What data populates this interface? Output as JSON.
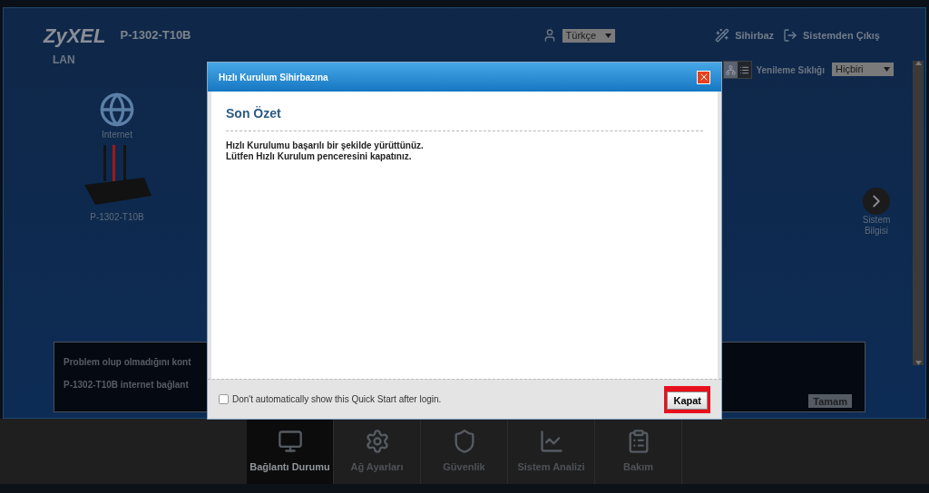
{
  "header": {
    "logo": "ZyXEL",
    "model": "P-1302-T10B",
    "language": {
      "value": "Türkçe"
    },
    "links": [
      {
        "label": "Sihirbaz",
        "kind": "wizard"
      },
      {
        "label": "Sistemden Çıkış",
        "kind": "logout"
      }
    ]
  },
  "page": {
    "title": "LAN",
    "refresh_label": "Yenileme Sıklığı",
    "refresh": {
      "value": "Hiçbiri"
    },
    "view_toggle": [
      {
        "kind": "diagram",
        "selected": true
      },
      {
        "kind": "list",
        "selected": false
      }
    ]
  },
  "diagram": {
    "internet_label": "Internet",
    "device_label": "P-1302-T10B"
  },
  "side_link": {
    "label": "Sistem Bilgisi"
  },
  "notice": {
    "lines": [
      "Problem olup olmadığını kont",
      "P-1302-T10B internet bağlant"
    ],
    "button": "Tamam"
  },
  "nav": [
    {
      "label": "Bağlantı Durumu",
      "kind": "status",
      "selected": true
    },
    {
      "label": "Ağ Ayarları",
      "kind": "network",
      "selected": false
    },
    {
      "label": "Güvenlik",
      "kind": "security",
      "selected": false
    },
    {
      "label": "Sistem Analizi",
      "kind": "analysis",
      "selected": false
    },
    {
      "label": "Bakım",
      "kind": "maintenance",
      "selected": false
    }
  ],
  "dialog": {
    "title": "Hızlı Kurulum Sihirbazına",
    "heading": "Son Özet",
    "message": [
      "Hızlı Kurulumu başarılı bir şekilde yürüttünüz.",
      "Lütfen Hızlı Kurulum penceresini kapatınız."
    ],
    "checkbox": {
      "label": "Don't automatically show this Quick Start after login.",
      "checked": false
    },
    "button": {
      "label": "Kapat",
      "highlighted": true
    }
  }
}
